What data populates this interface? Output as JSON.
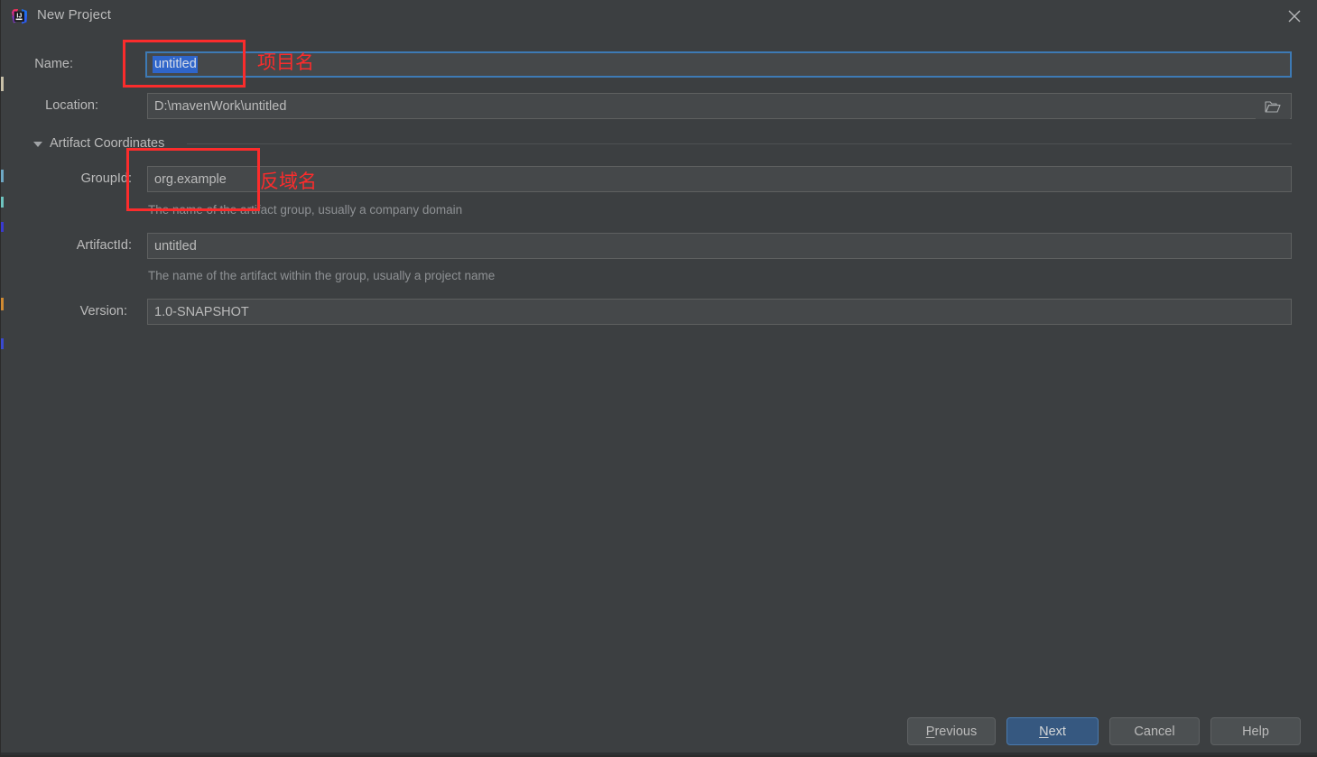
{
  "window": {
    "title": "New Project",
    "app_icon": "intellij-idea-icon",
    "close_icon": "close-icon",
    "background_color": "#3c3f41",
    "accent_color": "#365880",
    "annotation_color": "#fb2c2c"
  },
  "form": {
    "name": {
      "label": "Name:",
      "value": "untitled",
      "selected": true,
      "focused": true
    },
    "location": {
      "label": "Location:",
      "value": "D:\\mavenWork\\untitled",
      "browse_icon": "folder-icon"
    },
    "artifact_coordinates": {
      "title": "Artifact Coordinates",
      "expanded": true,
      "collapse_icon": "chevron-down-icon",
      "group_id": {
        "label": "GroupId:",
        "value": "org.example",
        "hint": "The name of the artifact group, usually a company domain"
      },
      "artifact_id": {
        "label": "ArtifactId:",
        "value": "untitled",
        "hint": "The name of the artifact within the group, usually a project name"
      },
      "version": {
        "label": "Version:",
        "value": "1.0-SNAPSHOT"
      }
    }
  },
  "annotations": [
    {
      "text": "项目名",
      "target": "name-field"
    },
    {
      "text": "反域名",
      "target": "group-id-field"
    }
  ],
  "buttons": {
    "previous": {
      "label_pre": "",
      "mnemonic": "P",
      "label_post": "revious"
    },
    "next": {
      "label_pre": "",
      "mnemonic": "N",
      "label_post": "ext",
      "primary": true
    },
    "cancel": {
      "label": "Cancel"
    },
    "help": {
      "label": "Help"
    }
  }
}
